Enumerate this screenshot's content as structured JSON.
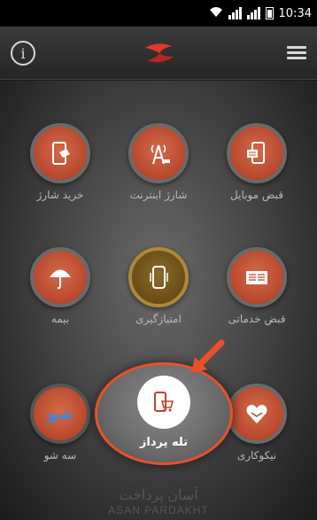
{
  "status_bar": {
    "time": "10:34"
  },
  "header": {
    "info_symbol": "i"
  },
  "tiles": {
    "mobile_bill": "قبض موبایل",
    "internet_charge": "شارژ اینترنت",
    "buy_charge": "خرید شارژ",
    "service_bill": "قبض خدماتی",
    "points": "امتیازگیری",
    "insurance": "بیمه",
    "charity": "نیکوکاری",
    "telepardaz": "تله پرداز",
    "se_show": "سه شو"
  },
  "se_show_icon_text": "شو",
  "brand": {
    "fa": "آسان پرداخت",
    "en": "ASAN PARDAKHT"
  },
  "colors": {
    "accent": "#e8512a",
    "tile": "#b8482c",
    "gold": "#b08838"
  }
}
